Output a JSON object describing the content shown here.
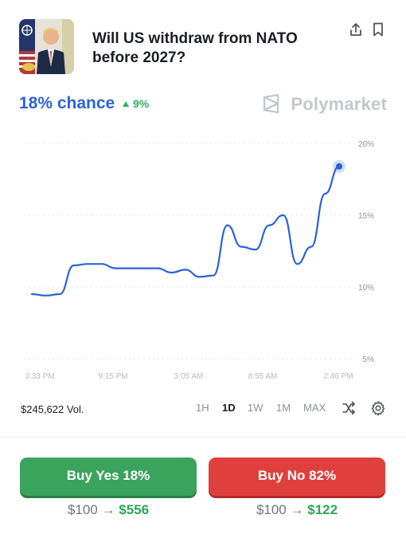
{
  "market": {
    "title": "Will US withdraw from NATO before 2027?",
    "chance_text": "18% chance",
    "change_text": "9%",
    "brand": "Polymarket"
  },
  "header": {
    "share_icon": "share-icon",
    "bookmark_icon": "bookmark-icon"
  },
  "chart_data": {
    "type": "line",
    "x": [
      "3:33 PM",
      "",
      "",
      "",
      "",
      "",
      "9:15 PM",
      "",
      "",
      "",
      "",
      "",
      "3:05 AM",
      "",
      "",
      "",
      "",
      "",
      "8:55 AM",
      "",
      "",
      "",
      "",
      "",
      "2:46 PM"
    ],
    "x_ticks": [
      "3:33 PM",
      "9:15 PM",
      "3:05 AM",
      "8:55 AM",
      "2:46 PM"
    ],
    "y_ticks": [
      "20%",
      "15%",
      "10%",
      "5%"
    ],
    "ylim": [
      5,
      20
    ],
    "series": [
      {
        "values": [
          9.5,
          9.4,
          9.5,
          11.5,
          11.6,
          11.6,
          11.3,
          11.3,
          11.3,
          11.3,
          11.0,
          11.2,
          10.7,
          10.8,
          14.3,
          12.8,
          12.6,
          14.3,
          15.0,
          11.6,
          12.8,
          16.5,
          18.4
        ]
      }
    ],
    "color": "#2b62d6",
    "grid": true
  },
  "controls": {
    "volume": "$245,622 Vol.",
    "ranges": [
      "1H",
      "1D",
      "1W",
      "1M",
      "MAX"
    ],
    "active_range": "1D"
  },
  "actions": {
    "yes_label": "Buy Yes 18%",
    "no_label": "Buy No 82%",
    "yes_stake": "$100",
    "yes_win": "$556",
    "no_stake": "$100",
    "no_win": "$122",
    "arrow": "→"
  }
}
